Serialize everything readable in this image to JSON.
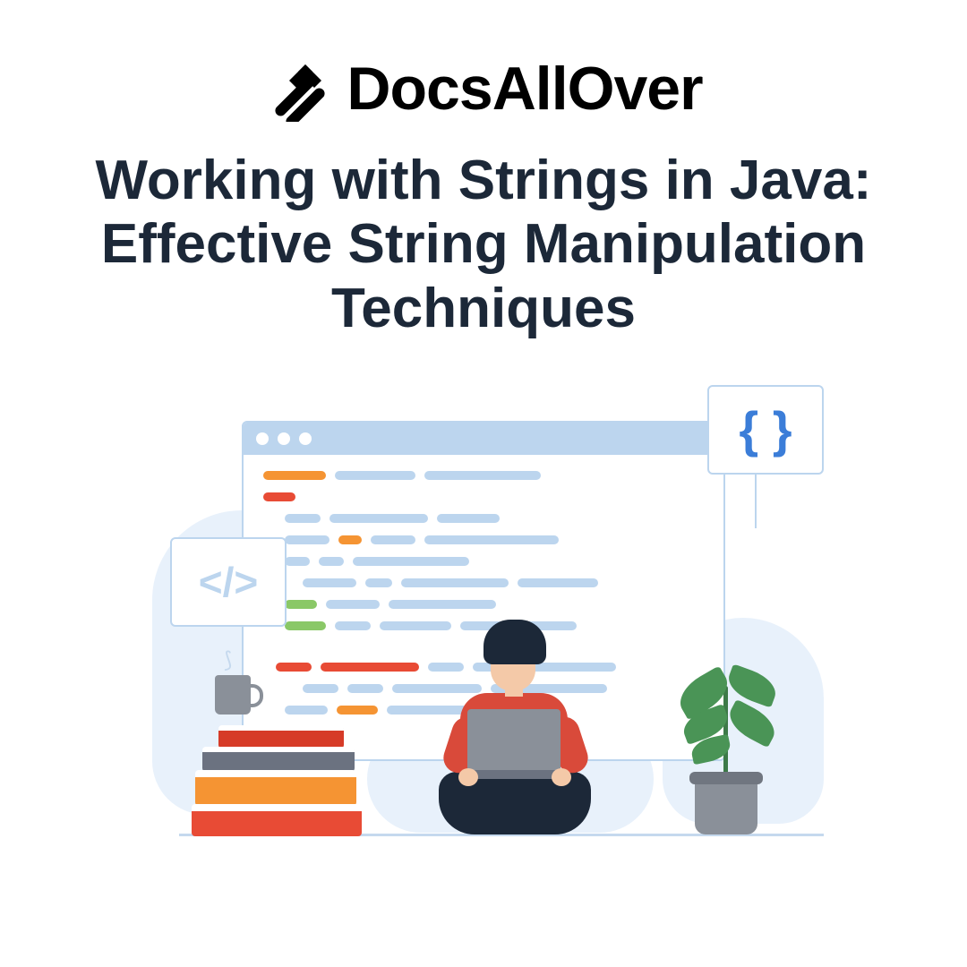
{
  "brand": {
    "name": "DocsAllOver",
    "icon": "docsallover-logo-icon"
  },
  "title": "Working with Strings in Java: Effective String Manipulation Techniques",
  "illustration": {
    "codeBox": {
      "label": "</>"
    },
    "bracesBox": {
      "label": "{ }"
    },
    "elements": {
      "mug": "coffee-mug",
      "books": "stacked-books",
      "person": "developer-with-laptop",
      "plant": "potted-plant",
      "codeWindow": "code-editor-window"
    }
  }
}
